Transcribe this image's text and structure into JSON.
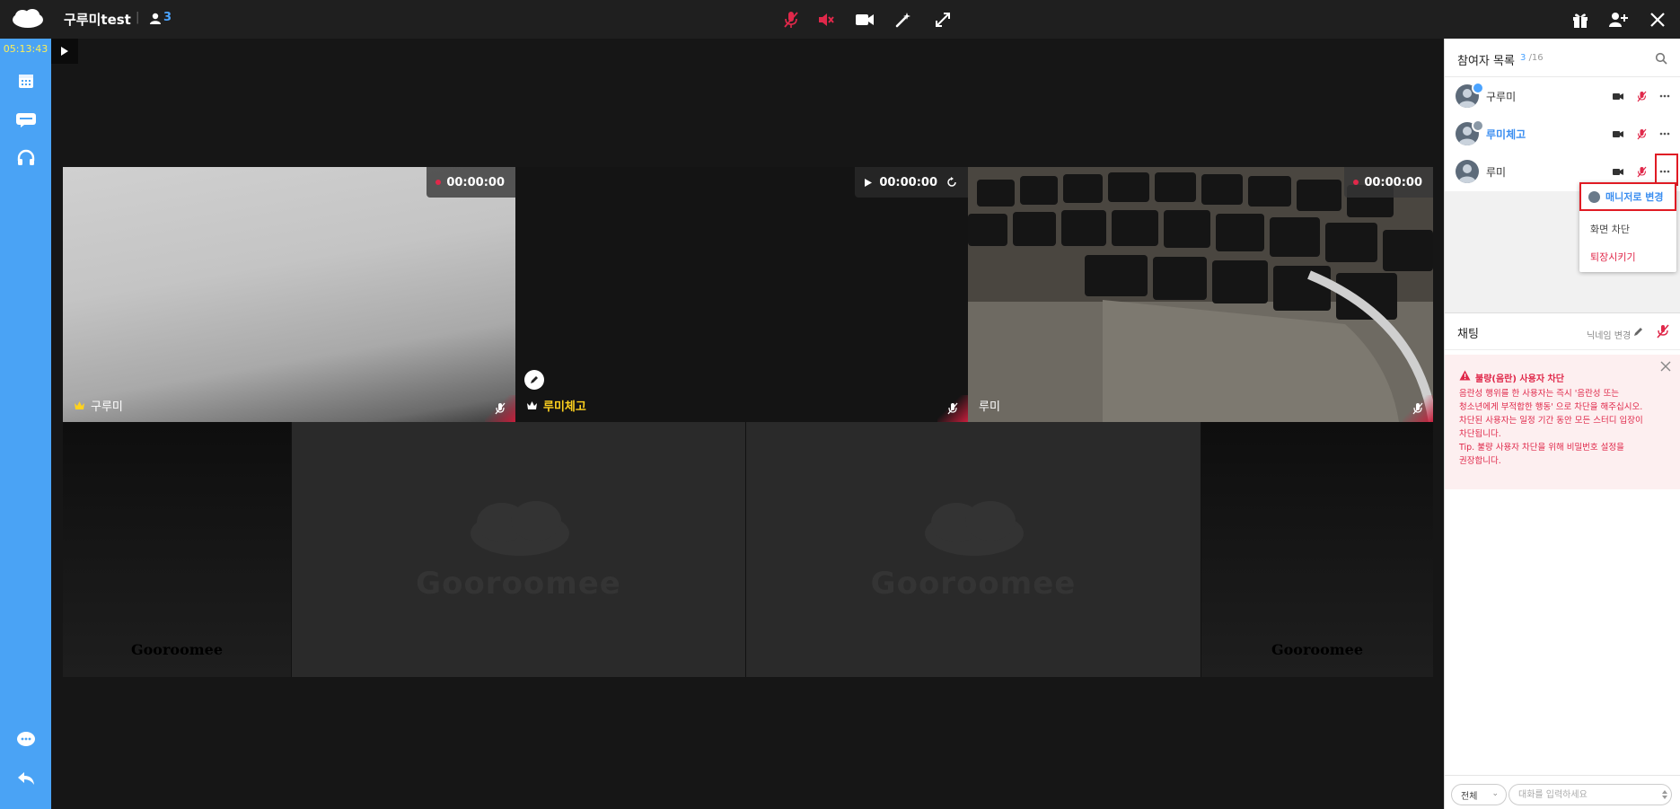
{
  "header": {
    "room_title": "구루미test",
    "separator": "|",
    "user_count": "3"
  },
  "sidebar": {
    "timer": "05:13:43"
  },
  "tiles": [
    {
      "name": "구루미",
      "record_time": "00:00:00"
    },
    {
      "name": "루미체고",
      "record_time": "00:00:00"
    },
    {
      "name": "루미",
      "record_time": "00:00:00"
    }
  ],
  "placeholders": {
    "brand": "Gooroomee"
  },
  "participants": {
    "title": "참여자 목록",
    "count": "3",
    "total": "/16",
    "list": [
      {
        "name": "구루미"
      },
      {
        "name": "루미체고"
      },
      {
        "name": "루미"
      }
    ]
  },
  "context_menu": {
    "make_manager": "매니저로 변경",
    "block_screen": "화면 차단",
    "kick": "퇴장시키기"
  },
  "chat": {
    "title": "채팅",
    "nickname_change": "닉네임 변경",
    "notice_title": "불량(음란) 사용자 차단",
    "notice_lines": [
      "음란성 행위를 한 사용자는 즉시 '음란성 또는",
      "청소년에게 부적합한 행동' 으로 차단을 해주십시오.",
      "차단된 사용자는 일정 기간 동안 모든 스터디 입장이",
      "차단됩니다.",
      "Tip. 불량 사용자 차단을 위해 비밀번호 설정을",
      "권장합니다."
    ],
    "target": "전체",
    "input_placeholder": "대화를 입력하세요"
  },
  "colors": {
    "accent": "#4aa3f5",
    "danger": "#e0284a",
    "timer": "#ffee55"
  }
}
